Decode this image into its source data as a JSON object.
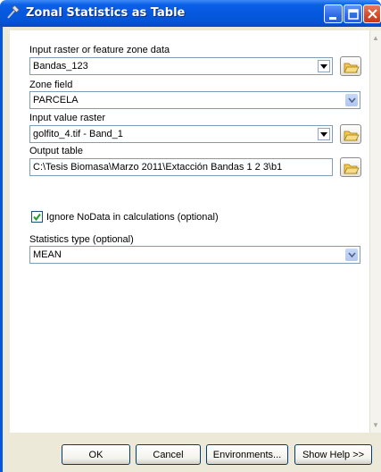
{
  "window": {
    "title": "Zonal Statistics as Table"
  },
  "form": {
    "input_zone": {
      "label": "Input raster or feature zone data",
      "value": "Bandas_123"
    },
    "zone_field": {
      "label": "Zone field",
      "value": "PARCELA"
    },
    "input_value": {
      "label": "Input value raster",
      "value": "golfito_4.tif - Band_1"
    },
    "output_table": {
      "label": "Output table",
      "value": "C:\\Tesis Biomasa\\Marzo 2011\\Extacción Bandas 1 2 3\\b1"
    },
    "ignore_nodata": {
      "label": "Ignore NoData in calculations (optional)",
      "checked": true
    },
    "stats_type": {
      "label": "Statistics type (optional)",
      "value": "MEAN"
    }
  },
  "buttons": {
    "ok": "OK",
    "cancel": "Cancel",
    "environments": "Environments...",
    "show_help": "Show Help >>"
  },
  "icons": {
    "title": "hammer-tool-icon",
    "browse": "open-folder-icon",
    "dropdown": "chevron-down-icon"
  }
}
